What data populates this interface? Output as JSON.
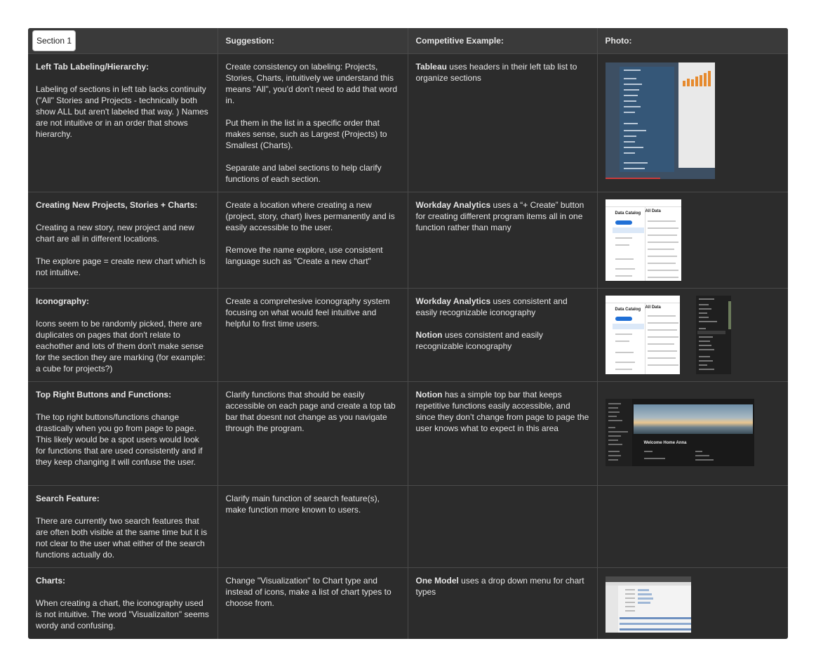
{
  "header": {
    "section_label": "Section 1",
    "suggestion": "Suggestion:",
    "competitive": "Competitive Example:",
    "photo": "Photo:"
  },
  "rows": [
    {
      "title": "Left Tab Labeling/Hierarchy:",
      "body": "Labeling of sections in left tab lacks continuity (\"All\" Stories and Projects - technically both show ALL but aren't labeled that way. ) Names are not intuitive or in an order that shows hierarchy.",
      "suggestion": [
        "Create consistency on labeling: Projects, Stories, Charts, intuitively we understand this means \"All\", you'd don't need to add that word in.",
        "Put them in the list in a specific order that makes sense, such as Largest (Projects) to Smallest (Charts).",
        "Separate and label sections to help clarify functions of each section."
      ],
      "examples": [
        {
          "brand": "Tableau",
          "text": " uses headers in their left tab list to organize sections"
        }
      ],
      "photo": "tableau-screenshot"
    },
    {
      "title": "Creating New Projects, Stories + Charts:",
      "body": "Creating a new story, new project and new chart are all in different locations.",
      "body2": "The explore page = create new chart which is not intuitive.",
      "suggestion": [
        "Create a location where creating a new (project, story, chart) lives permanently and is easily accessible to the user.",
        "Remove the name explore, use consistent language such as \"Create a new chart\""
      ],
      "examples": [
        {
          "brand": "Workday Analytics",
          "text": " uses a “+ Create” button for creating different program items all in one function rather than many"
        }
      ],
      "photo": "workday-screenshot"
    },
    {
      "title": "Iconography:",
      "body": "Icons seem to be randomly picked, there are duplicates on pages that don't relate to eachother and lots of them don't make sense for the section they are marking (for example: a cube for projects?)",
      "suggestion": [
        "Create a comprehesive iconography system focusing on what would feel intuitive and helpful to first time users."
      ],
      "examples": [
        {
          "brand": "Workday Analytics",
          "text": " uses consistent and easily recognizable iconography"
        },
        {
          "brand": "Notion",
          "text": " uses consistent and easily recognizable iconography"
        }
      ],
      "photo": "workday-notion-screenshots"
    },
    {
      "title": "Top Right Buttons and Functions:",
      "body": "The top right buttons/functions change drastically when you go from page to page. This likely would be a spot users would look for functions that are used consistently and if they keep changing it will confuse the user.",
      "suggestion": [
        "Clarify functions that should be easily accessible on each page and create a top tab bar that doesnt not change as you navigate through the program."
      ],
      "examples": [
        {
          "brand": "Notion",
          "text": " has a simple top bar that keeps repetitive functions easily accessible, and since they don’t change from page to page the user knows what to expect in this area"
        }
      ],
      "photo": "notion-screenshot"
    },
    {
      "title": "Search Feature:",
      "body": "There are currently two search features that are often both visible at the same time but it is not clear to the user what either of the search functions actually do.",
      "suggestion": [
        "Clarify main function of search feature(s), make function more known to users."
      ],
      "examples": [],
      "photo": ""
    },
    {
      "title": "Charts:",
      "body": "When creating a chart, the iconography used is not intuitive. The word \"Visualizaiton\" seems wordy and confusing.",
      "suggestion": [
        "Change \"Visualization\" to Chart type and instead of icons, make a list of chart types to choose from."
      ],
      "examples": [
        {
          "brand": "One Model",
          "text": " uses a drop down menu for chart types"
        }
      ],
      "photo": "one-model-screenshot"
    }
  ],
  "thumbnails": {
    "workday_title": "Data Catalog",
    "workday_title2": "All Data",
    "notion_welcome": "Welcome Home Anna"
  },
  "colors": {
    "board": "#2c2c2c",
    "header_bg": "#3a3a3a",
    "grid_line": "#4a4a4a",
    "text": "#e6e6e6"
  }
}
